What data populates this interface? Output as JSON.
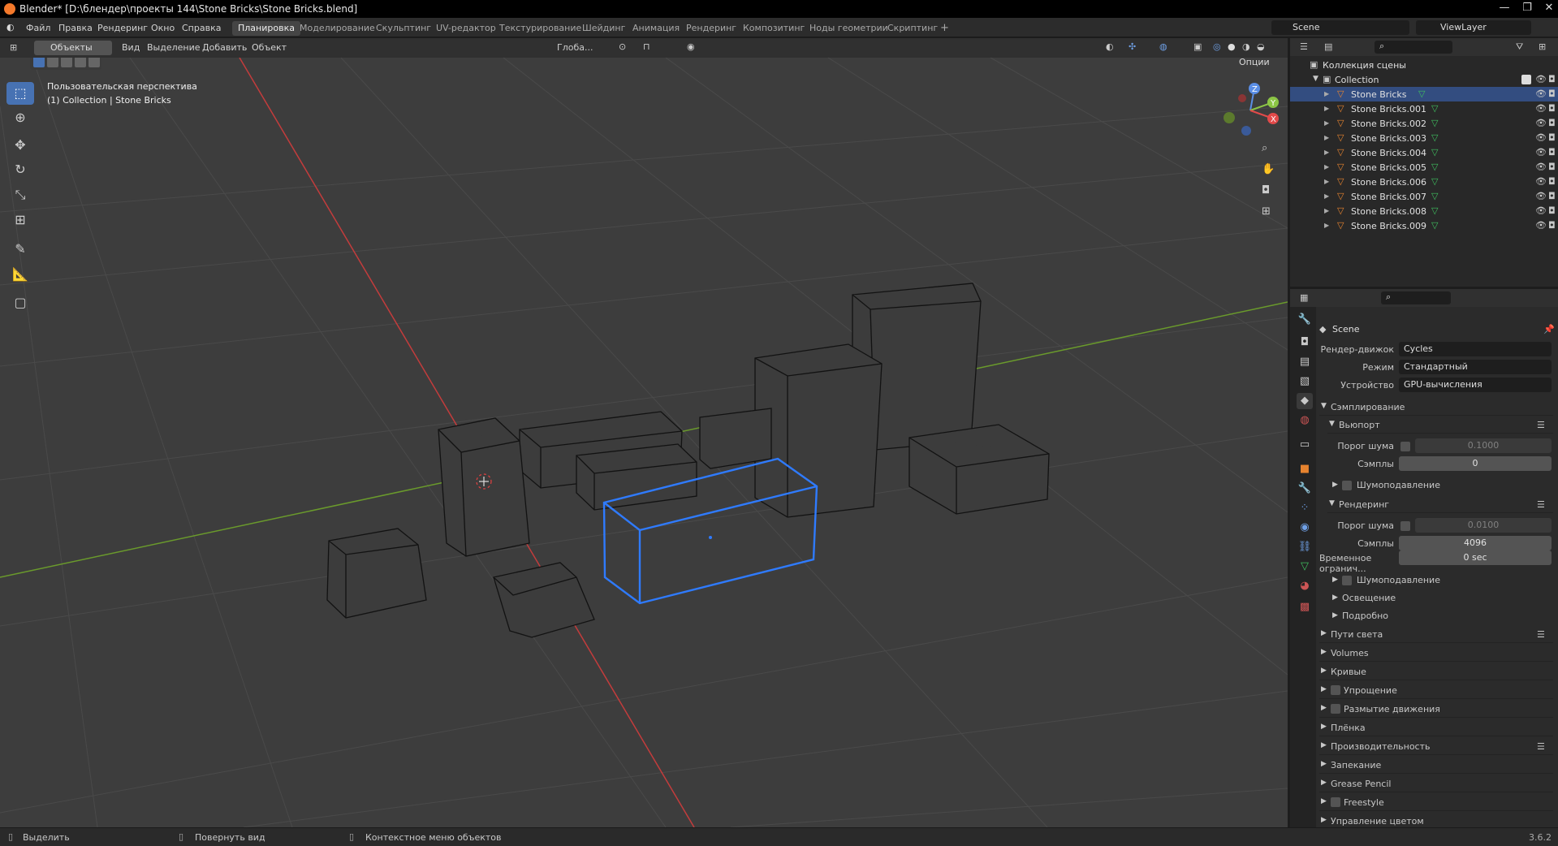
{
  "window": {
    "title": "Blender* [D:\\блендер\\проекты 144\\Stone Bricks\\Stone Bricks.blend]"
  },
  "menus": [
    "Файл",
    "Правка",
    "Рендеринг",
    "Окно",
    "Справка"
  ],
  "workspaces": [
    "Планировка",
    "Моделирование",
    "Скульптинг",
    "UV-редактор",
    "Текстурирование",
    "Шейдинг",
    "Анимация",
    "Рендеринг",
    "Композитинг",
    "Ноды геометрии",
    "Скриптинг"
  ],
  "scene": {
    "name": "Scene",
    "view_layer": "ViewLayer"
  },
  "viewport": {
    "mode": "Объекты",
    "menus": [
      "Вид",
      "Выделение",
      "Добавить",
      "Объект"
    ],
    "transform_orientation": "Глоба...",
    "options": "Опции",
    "overlay_line1": "Пользовательская перспектива",
    "overlay_line2": "(1) Collection | Stone Bricks",
    "gizmo_axes": [
      "Z",
      "Y",
      "X"
    ]
  },
  "outliner": {
    "scene_collection": "Коллекция сцены",
    "collection": "Collection",
    "objects": [
      "Stone Bricks",
      "Stone Bricks.001",
      "Stone Bricks.002",
      "Stone Bricks.003",
      "Stone Bricks.004",
      "Stone Bricks.005",
      "Stone Bricks.006",
      "Stone Bricks.007",
      "Stone Bricks.008",
      "Stone Bricks.009"
    ],
    "selected_index": 0
  },
  "properties": {
    "context": "Scene",
    "render_engine_label": "Рендер-движок",
    "render_engine": "Cycles",
    "mode_label": "Режим",
    "mode": "Стандартный",
    "device_label": "Устройство",
    "device": "GPU-вычисления",
    "sampling": "Сэмплирование",
    "viewport_section": "Вьюпорт",
    "noise_threshold_label": "Порог шума",
    "viewport_noise_threshold": "0.1000",
    "samples_label": "Сэмплы",
    "viewport_samples": "0",
    "denoise": "Шумоподавление",
    "render_section": "Рендеринг",
    "render_noise_threshold": "0.0100",
    "render_samples": "4096",
    "time_limit_label": "Временное огранич...",
    "time_limit": "0 sec",
    "sub_sections": [
      "Освещение",
      "Подробно"
    ],
    "panels": [
      "Пути света",
      "Volumes",
      "Кривые",
      "Упрощение",
      "Размытие движения",
      "Плёнка",
      "Производительность",
      "Запекание",
      "Grease Pencil",
      "Freestyle",
      "Управление цветом"
    ]
  },
  "status": {
    "select": "Выделить",
    "rotate": "Повернуть вид",
    "context_menu": "Контекстное меню объектов",
    "version": "3.6.2"
  },
  "colors": {
    "accent": "#4772b3",
    "selection": "#334d80",
    "x_axis": "#c33c3c",
    "y_axis": "#6a9a2c",
    "active_outline": "#2f7bff",
    "viewport_bg": "#3d3d3d"
  }
}
